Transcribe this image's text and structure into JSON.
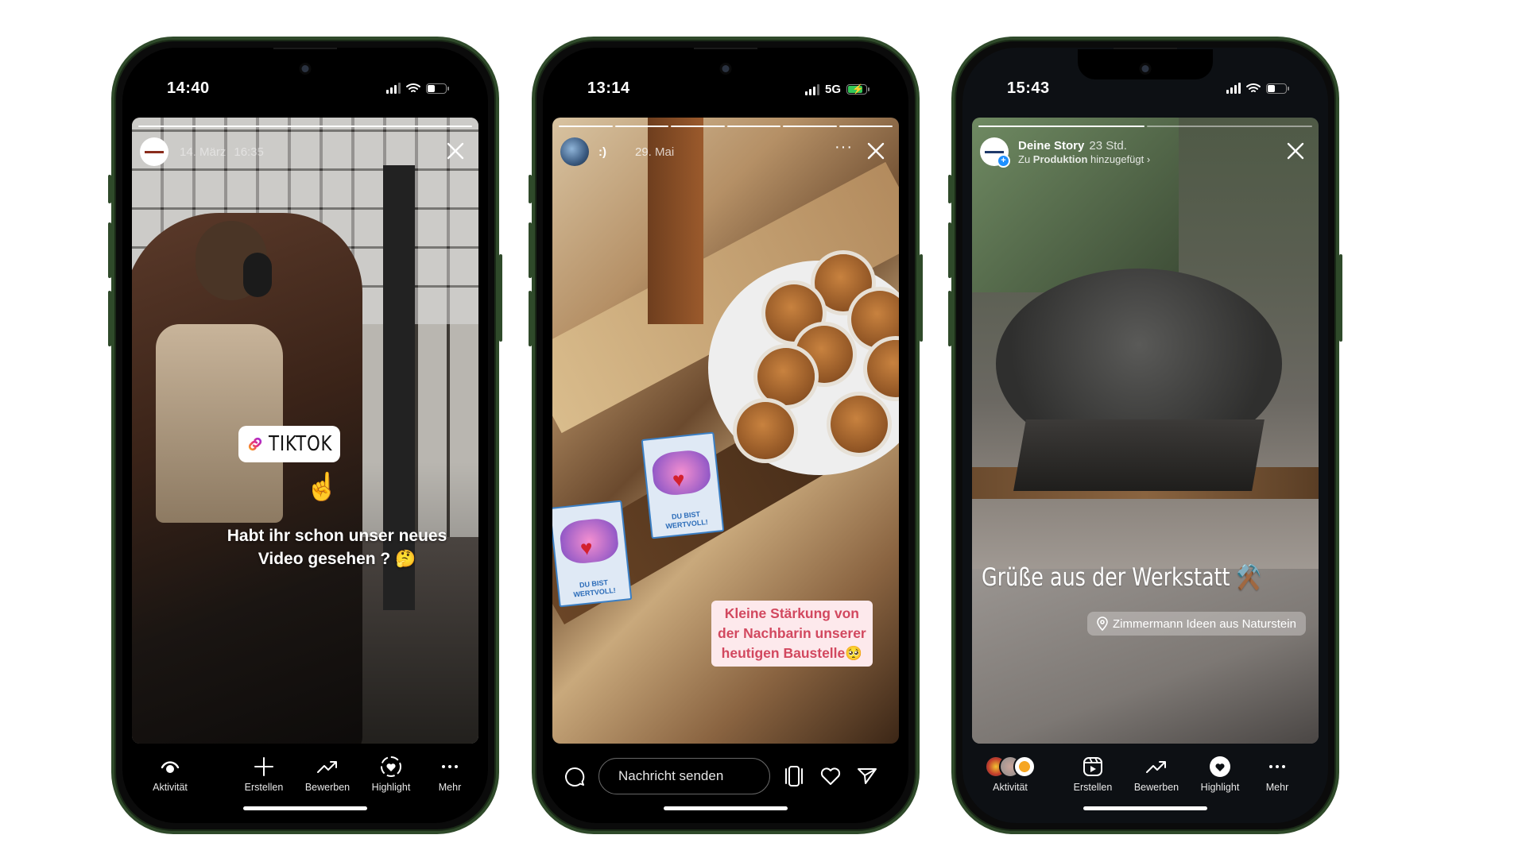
{
  "phones": [
    {
      "status": {
        "time": "14:40",
        "network": "",
        "battery": "low"
      },
      "story": {
        "progress_segments": 1,
        "progress_done": 1,
        "account_name": "",
        "date": "14. März",
        "time": "16:35",
        "sticker_link_label": "TIKTOK",
        "caption_line1": "Habt ihr schon unser neues",
        "caption_line2": "Video gesehen ? 🤔"
      },
      "toolbar": [
        {
          "icon": "eye-icon",
          "label": "Aktivität"
        },
        {
          "icon": "plus-icon",
          "label": "Erstellen"
        },
        {
          "icon": "trending-icon",
          "label": "Bewerben"
        },
        {
          "icon": "highlight-heart-icon",
          "label": "Highlight"
        },
        {
          "icon": "more-icon",
          "label": "Mehr"
        }
      ]
    },
    {
      "status": {
        "time": "13:14",
        "network": "5G",
        "battery": "charging"
      },
      "story": {
        "progress_segments": 6,
        "progress_done": 6,
        "account_name": ":)",
        "date": "29. Mai",
        "card_text_line1": "DU BIST",
        "card_text_line2": "WERTVOLL!",
        "caption_line1": "Kleine Stärkung von",
        "caption_line2": "der Nachbarin unserer",
        "caption_line3": "heutigen Baustelle🥺"
      },
      "reply_bar": {
        "placeholder": "Nachricht senden",
        "icons": [
          "camera-chat-icon",
          "carousel-icon",
          "heart-icon",
          "send-icon"
        ]
      }
    },
    {
      "status": {
        "time": "15:43",
        "network": "",
        "battery": "low"
      },
      "story": {
        "progress_segments": 2,
        "progress_done": 1,
        "account_name": "Deine Story",
        "age": "23 Std.",
        "added_to_prefix": "Zu",
        "added_to_highlight": "Produktion",
        "added_to_suffix": "hinzugefügt",
        "caption": "Grüße aus der Werkstatt ⚒️",
        "location": "Zimmermann Ideen aus Naturstein"
      },
      "toolbar": [
        {
          "icon": "viewer-avatars",
          "label": "Aktivität"
        },
        {
          "icon": "reels-icon",
          "label": "Erstellen"
        },
        {
          "icon": "trending-icon",
          "label": "Bewerben"
        },
        {
          "icon": "heart-filled-circle-icon",
          "label": "Highlight"
        },
        {
          "icon": "more-icon",
          "label": "Mehr"
        }
      ]
    }
  ],
  "colors": {
    "frame": "#2f4a2a",
    "caption_pink": "#d2485f",
    "caption_bg": "#fde9ec",
    "battery_charging": "#34c759",
    "badge_blue": "#1e90ff"
  }
}
